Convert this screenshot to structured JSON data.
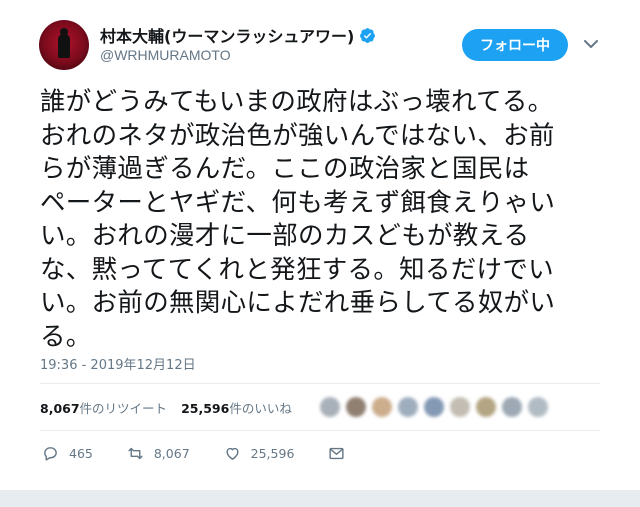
{
  "author": {
    "display_name": "村本大輔(ウーマンラッシュアワー)",
    "handle": "@WRHMURAMOTO",
    "verified": true
  },
  "follow_button": {
    "label": "フォロー中"
  },
  "tweet": {
    "text": "誰がどうみてもいまの政府はぶっ壊れてる。\nおれのネタが政治色が強いんではない、お前\nらが薄過ぎるんだ。ここの政治家と国民は\nペーターとヤギだ、何も考えず餌食えりゃい\nい。おれの漫才に一部のカスどもが教える\nな、黙っててくれと発狂する。知るだけでい\nい。お前の無関心によだれ垂らしてる奴がい\nる。",
    "timestamp": "19:36 - 2019年12月12日"
  },
  "stats": {
    "retweets_count": "8,067",
    "retweets_label": "件のリツイート",
    "likes_count": "25,596",
    "likes_label": "件のいいね"
  },
  "actions": {
    "reply_count": "465",
    "retweet_count": "8,067",
    "like_count": "25,596"
  },
  "icons": [
    "reply-icon",
    "retweet-icon",
    "like-icon",
    "message-icon",
    "verified-icon",
    "chevron-down-icon"
  ],
  "colors": {
    "accent": "#1da1f2",
    "muted": "#657786",
    "text": "#14171a"
  }
}
